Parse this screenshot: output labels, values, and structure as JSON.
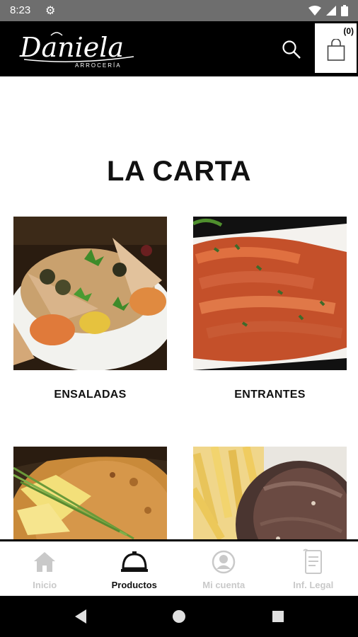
{
  "status_bar": {
    "time": "8:23",
    "gear_icon": "settings-gear-icon",
    "wifi_icon": "wifi-icon",
    "signal_icon": "signal-icon",
    "battery_icon": "battery-icon"
  },
  "header": {
    "logo_script": "Daniela",
    "logo_sub": "ARROCERÍA",
    "search_icon": "search-icon",
    "cart_count": "(0)",
    "cart_icon": "shopping-bag-icon"
  },
  "main": {
    "title": "LA CARTA",
    "categories": [
      {
        "label": "ENSALADAS",
        "image": "salad-photo"
      },
      {
        "label": "ENTRANTES",
        "image": "prawns-photo"
      },
      {
        "label": "",
        "image": "paella-photo"
      },
      {
        "label": "",
        "image": "steak-fries-photo"
      }
    ]
  },
  "bottom_nav": {
    "items": [
      {
        "label": "Inicio",
        "icon": "home-icon",
        "active": false
      },
      {
        "label": "Productos",
        "icon": "serving-cloche-icon",
        "active": true
      },
      {
        "label": "Mi cuenta",
        "icon": "user-icon",
        "active": false
      },
      {
        "label": "Inf. Legal",
        "icon": "document-icon",
        "active": false
      }
    ]
  },
  "colors": {
    "header_bg": "#000000",
    "status_bg": "#6e6e6e",
    "inactive_nav": "#c9c9c9",
    "active_nav": "#111111"
  }
}
